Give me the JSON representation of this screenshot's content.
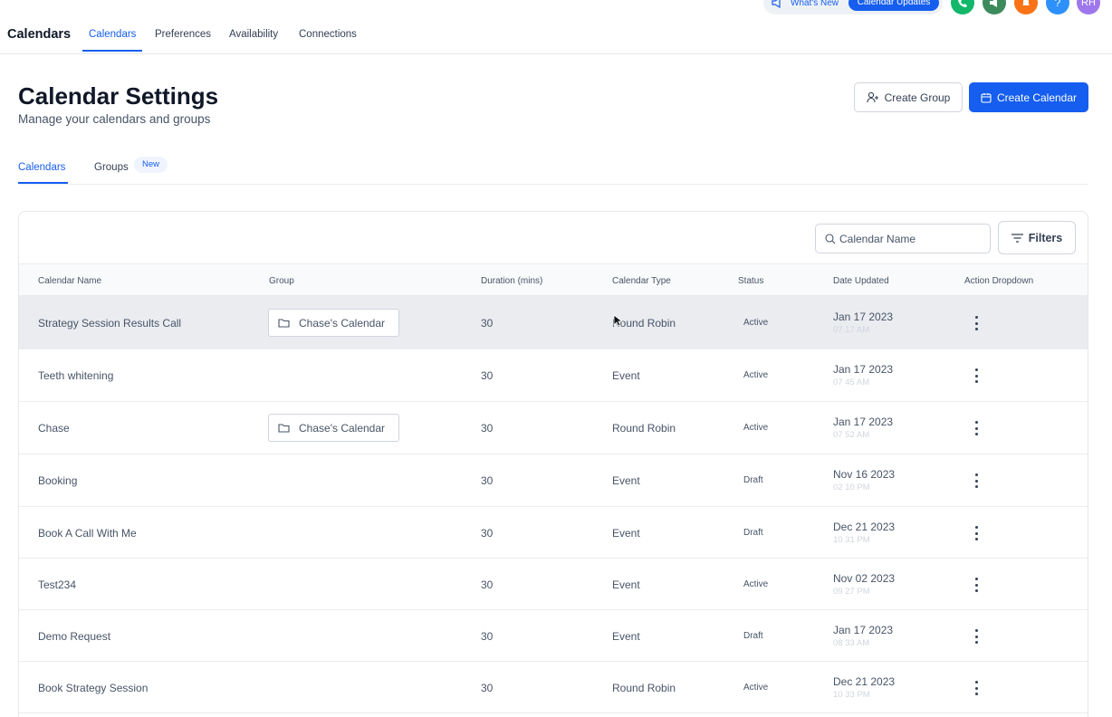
{
  "header": {
    "app_title": "Calendars",
    "nav_tabs": [
      {
        "label": "Calendars",
        "active": true
      },
      {
        "label": "Preferences",
        "active": false
      },
      {
        "label": "Availability",
        "active": false
      },
      {
        "label": "Connections",
        "active": false
      }
    ],
    "whats_new_label": "What's New",
    "updates_badge": "Calendar Updates",
    "action_buttons": [
      {
        "icon": "phone-icon",
        "color": "#12b76a"
      },
      {
        "icon": "megaphone-icon",
        "color": "#3d8b5c"
      },
      {
        "icon": "bell-icon",
        "color": "#f97316"
      },
      {
        "icon": "help-icon",
        "color": "#2e90fa"
      }
    ],
    "avatar": {
      "initials": "RH",
      "color": "#9e77ed"
    }
  },
  "page": {
    "title": "Calendar Settings",
    "subtitle": "Manage your calendars and groups",
    "create_group_label": "Create Group",
    "create_calendar_label": "Create Calendar"
  },
  "sub_tabs": [
    {
      "label": "Calendars",
      "active": true
    },
    {
      "label": "Groups",
      "active": false,
      "badge": "New"
    }
  ],
  "toolbar": {
    "search_placeholder": "Calendar Name",
    "filters_label": "Filters"
  },
  "table": {
    "columns": [
      "Calendar Name",
      "Group",
      "Duration (mins)",
      "Calendar Type",
      "Status",
      "Date Updated",
      "Action Dropdown"
    ],
    "rows": [
      {
        "name": "Strategy Session Results Call",
        "group": "Chase's Calendar",
        "duration": "30",
        "type": "Round Robin",
        "status": "Active",
        "date": "Jan 17 2023",
        "time": "07 17 AM",
        "hover": true
      },
      {
        "name": "Teeth whitening",
        "group": "",
        "duration": "30",
        "type": "Event",
        "status": "Active",
        "date": "Jan 17 2023",
        "time": "07 45 AM"
      },
      {
        "name": "Chase",
        "group": "Chase's Calendar",
        "duration": "30",
        "type": "Round Robin",
        "status": "Active",
        "date": "Jan 17 2023",
        "time": "07 52 AM"
      },
      {
        "name": "Booking",
        "group": "",
        "duration": "30",
        "type": "Event",
        "status": "Draft",
        "date": "Nov 16 2023",
        "time": "02 10 PM"
      },
      {
        "name": "Book A Call With Me",
        "group": "",
        "duration": "30",
        "type": "Event",
        "status": "Draft",
        "date": "Dec 21 2023",
        "time": "10 31 PM"
      },
      {
        "name": "Test234",
        "group": "",
        "duration": "30",
        "type": "Event",
        "status": "Active",
        "date": "Nov 02 2023",
        "time": "09 27 PM"
      },
      {
        "name": "Demo Request",
        "group": "",
        "duration": "30",
        "type": "Event",
        "status": "Draft",
        "date": "Jan 17 2023",
        "time": "08 33 AM"
      },
      {
        "name": "Book Strategy Session",
        "group": "",
        "duration": "30",
        "type": "Round Robin",
        "status": "Active",
        "date": "Dec 21 2023",
        "time": "10 33 PM"
      }
    ]
  }
}
